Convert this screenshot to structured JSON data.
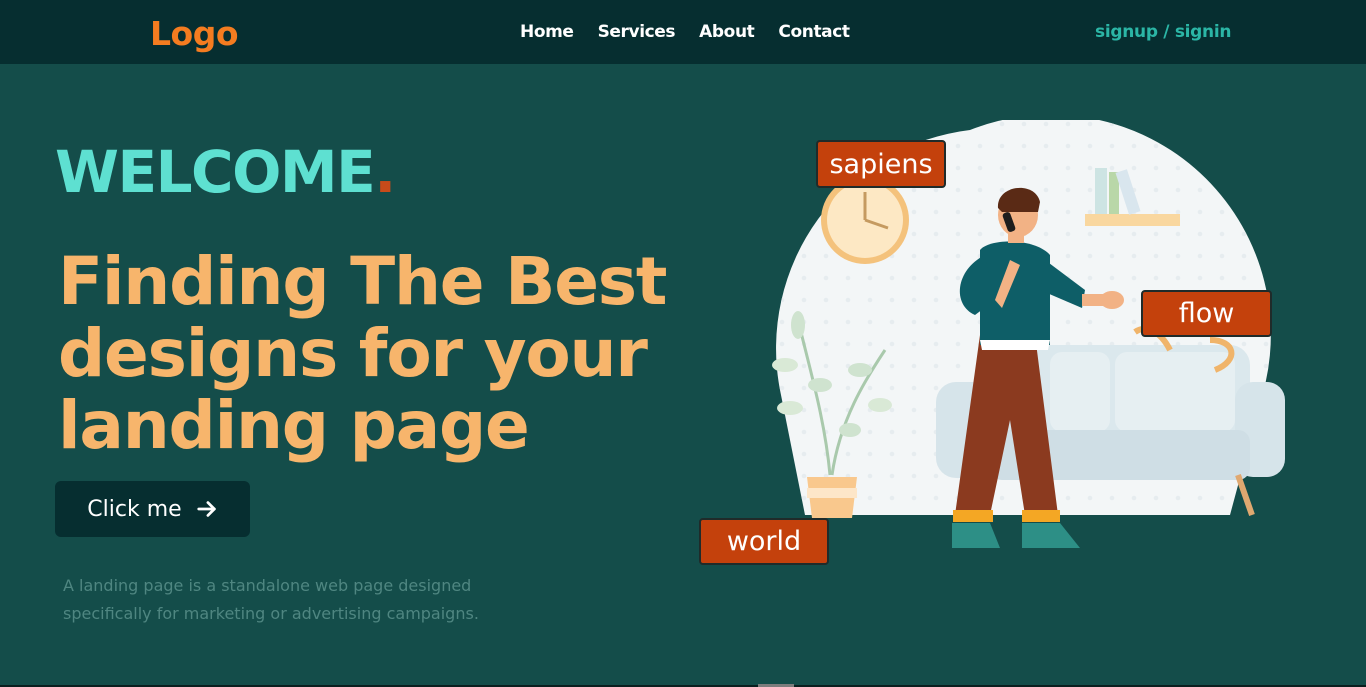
{
  "nav": {
    "logo": "Logo",
    "links": [
      "Home",
      "Services",
      "About",
      "Contact"
    ],
    "auth": "signup / signin"
  },
  "hero": {
    "welcome": "WELCOME",
    "welcome_dot": ".",
    "headline_lines": [
      "Finding The Best",
      "designs for your",
      "landing page"
    ],
    "cta_label": "Click me",
    "description": "A landing page is a standalone web page designed specifically for marketing or advertising campaigns."
  },
  "illustration": {
    "tags": [
      "sapiens",
      "flow",
      "world"
    ]
  },
  "colors": {
    "nav_bg": "#062e30",
    "page_bg": "#144d4a",
    "logo": "#f47c20",
    "welcome": "#5ee0d1",
    "headline": "#f7b56c",
    "auth": "#2bb6a6",
    "tag_bg": "#c4410c"
  },
  "icons": {
    "cta_icon": "arrow-right-icon"
  }
}
